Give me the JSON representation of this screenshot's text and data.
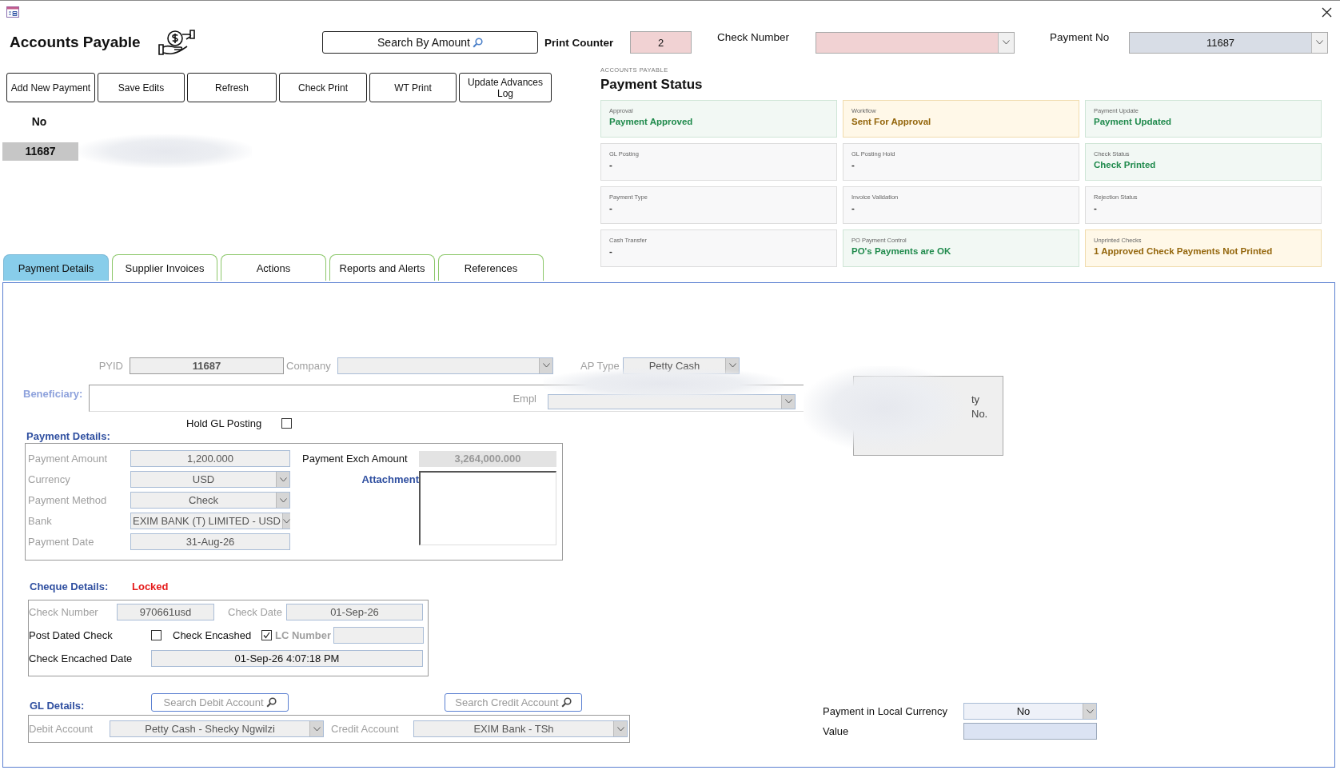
{
  "header": {
    "title": "Accounts Payable",
    "search_button": "Search By Amount",
    "print_counter": {
      "label": "Print Counter",
      "value": "2"
    },
    "check_number": {
      "label": "Check Number"
    },
    "payment_no": {
      "label": "Payment No",
      "value": "11687"
    }
  },
  "toolbar": [
    "Add New Payment",
    "Save Edits",
    "Refresh",
    "Check Print",
    "WT Print",
    "Update Advances Log"
  ],
  "record": {
    "label": "No",
    "value": "11687"
  },
  "status": {
    "overline": "ACCOUNTS PAYABLE",
    "title": "Payment Status",
    "cards": [
      {
        "label": "Approval",
        "value": "Payment Approved",
        "kind": "success"
      },
      {
        "label": "Workflow",
        "value": "Sent For Approval",
        "kind": "warning"
      },
      {
        "label": "Payment Update",
        "value": "Payment Updated",
        "kind": "success"
      },
      {
        "label": "GL Posting",
        "value": "-",
        "kind": "neutral"
      },
      {
        "label": "GL Posting Hold",
        "value": "-",
        "kind": "neutral"
      },
      {
        "label": "Check Status",
        "value": "Check Printed",
        "kind": "success"
      },
      {
        "label": "Payment Type",
        "value": "-",
        "kind": "neutral"
      },
      {
        "label": "Invoice Validation",
        "value": "-",
        "kind": "neutral"
      },
      {
        "label": "Rejection Status",
        "value": "-",
        "kind": "neutral"
      },
      {
        "label": "Cash Transfer",
        "value": "-",
        "kind": "neutral"
      },
      {
        "label": "PO Payment Control",
        "value": "PO's Payments are OK",
        "kind": "success"
      },
      {
        "label": "Unprinted Checks",
        "value": "1 Approved Check Payments Not Printed",
        "kind": "warning"
      }
    ]
  },
  "tabs": [
    {
      "label": "Payment Details",
      "selected": true
    },
    {
      "label": "Supplier Invoices",
      "selected": false
    },
    {
      "label": "Actions",
      "selected": false
    },
    {
      "label": "Reports and Alerts",
      "selected": false
    },
    {
      "label": "References",
      "selected": false
    }
  ],
  "form": {
    "pyid": {
      "label": "PYID",
      "value": "11687"
    },
    "company": {
      "label": "Company"
    },
    "ap_type": {
      "label": "AP Type",
      "value": "Petty Cash"
    },
    "beneficiary": {
      "label": "Beneficiary:",
      "employee_label": "Empl"
    },
    "side_box": [
      "ty",
      "No."
    ],
    "hold_gl": {
      "label": "Hold GL Posting",
      "checked": false
    },
    "payment_details": {
      "heading": "Payment Details:",
      "fields": [
        {
          "label": "Payment Amount",
          "value": "1,200.000",
          "kind": "text"
        },
        {
          "label": "Currency",
          "value": "USD",
          "kind": "combo"
        },
        {
          "label": "Payment Method",
          "value": "Check",
          "kind": "combo"
        },
        {
          "label": "Bank",
          "value": "EXIM BANK (T) LIMITED - USD",
          "kind": "combo"
        },
        {
          "label": "Payment Date",
          "value": "31-Aug-26",
          "kind": "text"
        }
      ],
      "exch": {
        "label": "Payment Exch Amount",
        "value": "3,264,000.000"
      },
      "attachment": {
        "label": "Attachment"
      }
    },
    "cheque": {
      "heading": "Cheque Details:",
      "lock_status": "Locked",
      "check_number": {
        "label": "Check Number",
        "value": "970661usd"
      },
      "check_date": {
        "label": "Check Date",
        "value": "01-Sep-26"
      },
      "post_dated": {
        "label": "Post Dated Check",
        "checked": false
      },
      "encashed": {
        "label": "Check Encashed",
        "checked": true
      },
      "lc_number": {
        "label": "LC Number"
      },
      "encashed_date": {
        "label": "Check Encached Date",
        "value": "01-Sep-26 4:07:18 PM"
      }
    },
    "gl": {
      "heading": "GL Details:",
      "search_debit": "Search Debit Account",
      "search_credit": "Search Credit Account",
      "debit": {
        "label": "Debit Account",
        "value": "Petty Cash - Shecky Ngwilzi"
      },
      "credit": {
        "label": "Credit Account",
        "value": "EXIM Bank - TSh"
      }
    },
    "local_currency": {
      "label": "Payment in Local Currency",
      "value": "No"
    },
    "value": {
      "label": "Value"
    }
  }
}
